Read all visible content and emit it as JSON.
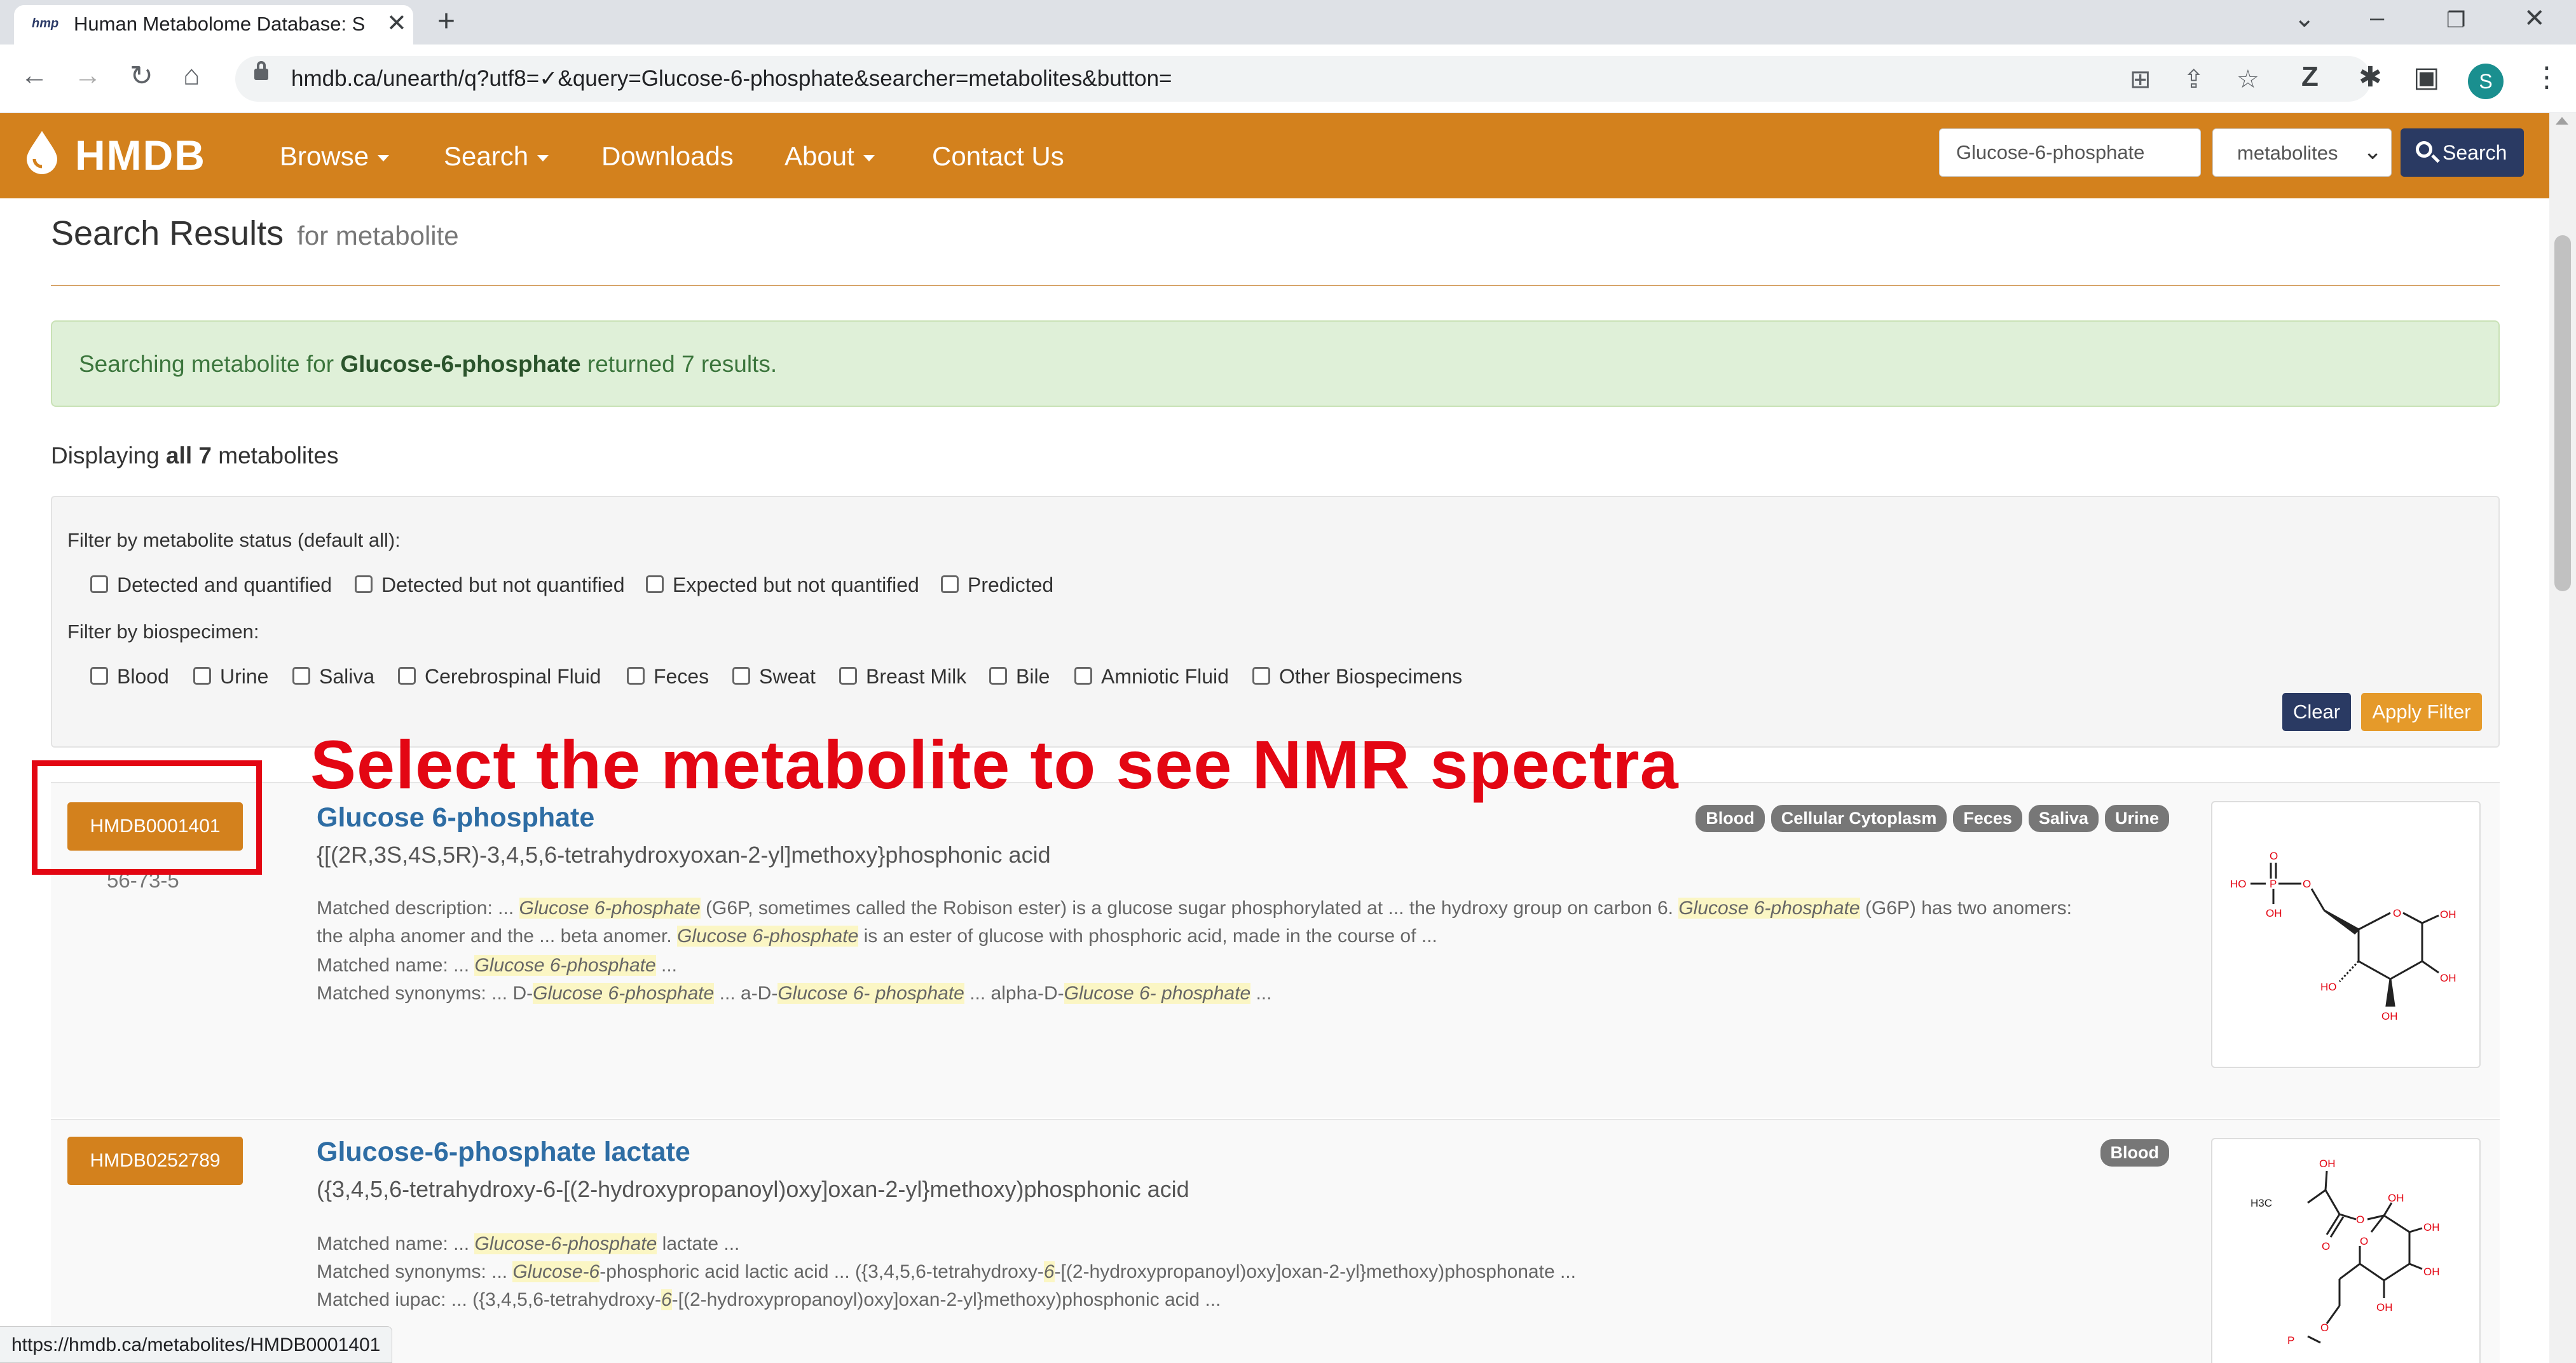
{
  "browser": {
    "tab_favicon": "hmp",
    "tab_title": "Human Metabolome Database: S",
    "url": "hmdb.ca/unearth/q?utf8=✓&query=Glucose-6-phosphate&searcher=metabolites&button=",
    "profile_initial": "S",
    "status_url": "https://hmdb.ca/metabolites/HMDB0001401"
  },
  "navbar": {
    "logo": "HMDB",
    "items": [
      "Browse",
      "Search",
      "Downloads",
      "About",
      "Contact Us"
    ],
    "search_value": "Glucose-6-phosphate",
    "searcher_selected": "metabolites",
    "search_button": "Search",
    "brand_color": "#d3811d"
  },
  "page": {
    "title": "Search Results",
    "title_suffix": "for metabolite",
    "alert_prefix": "Searching metabolite for ",
    "alert_query": "Glucose-6-phosphate",
    "alert_suffix": " returned 7 results.",
    "displaying_prefix": "Displaying ",
    "displaying_count": "all 7",
    "displaying_suffix": " metabolites"
  },
  "filters": {
    "status_label": "Filter by metabolite status (default all):",
    "status_options": [
      "Detected and quantified",
      "Detected but not quantified",
      "Expected but not quantified",
      "Predicted"
    ],
    "biospecimen_label": "Filter by biospecimen:",
    "biospecimen_options": [
      "Blood",
      "Urine",
      "Saliva",
      "Cerebrospinal Fluid",
      "Feces",
      "Sweat",
      "Breast Milk",
      "Bile",
      "Amniotic Fluid",
      "Other Biospecimens"
    ],
    "clear_label": "Clear",
    "apply_label": "Apply Filter"
  },
  "annotation": {
    "text": "Select the metabolite to see  NMR spectra",
    "color": "#e30613"
  },
  "results": [
    {
      "id": "HMDB0001401",
      "cas": "56-73-5",
      "name": "Glucose 6-phosphate",
      "iupac": "{[(2R,3S,4S,5R)-3,4,5,6-tetrahydroxyoxan-2-yl]methoxy}phosphonic acid",
      "tags": [
        "Blood",
        "Cellular Cytoplasm",
        "Feces",
        "Saliva",
        "Urine"
      ],
      "desc_label": "Matched description:",
      "desc_l1a": " ... ",
      "desc_hl1": "Glucose 6-phosphate",
      "desc_l1b": " (G6P, sometimes called the Robison ester) is a glucose sugar phosphorylated at ... the hydroxy group on carbon 6. ",
      "desc_hl2": "Glucose 6-phosphate",
      "desc_l1c": " (G6P) has two anomers:",
      "desc_l2a": "the alpha anomer and the ... beta anomer. ",
      "desc_hl3": "Glucose 6-phosphate",
      "desc_l2b": " is an ester of glucose with phosphoric acid, made in the course of ...",
      "name_label": "Matched name:",
      "name_a": " ... ",
      "name_hl": "Glucose 6-phosphate",
      "name_b": " ...",
      "syn_label": "Matched synonyms:",
      "syn_a": " ... D-",
      "syn_hl1": "Glucose 6-phosphate",
      "syn_b": " ... a-D-",
      "syn_hl2": "Glucose 6- phosphate",
      "syn_c": " ... alpha-D-",
      "syn_hl3": "Glucose 6- phosphate",
      "syn_d": " ..."
    },
    {
      "id": "HMDB0252789",
      "name": "Glucose-6-phosphate lactate",
      "iupac": "({3,4,5,6-tetrahydroxy-6-[(2-hydroxypropanoyl)oxy]oxan-2-yl}methoxy)phosphonic acid",
      "tags": [
        "Blood"
      ],
      "name_label": "Matched name:",
      "name_a": " ... ",
      "name_hl": "Glucose-6-phosphate",
      "name_b": " lactate ...",
      "syn_label": "Matched synonyms:",
      "syn_a": " ... ",
      "syn_hl1": "Glucose-6",
      "syn_b": "-phosphoric acid lactic acid ... ({3,4,5,6-tetrahydroxy-",
      "syn_hl2": "6",
      "syn_c": "-[(2-hydroxypropanoyl)oxy]oxan-2-yl}methoxy)phosphonate ...",
      "iupac_label": "Matched iupac:",
      "iu_a": " ... ({3,4,5,6-tetrahydroxy-",
      "iu_hl": "6",
      "iu_b": "-[(2-hydroxypropanoyl)oxy]oxan-2-yl}methoxy)phosphonic acid ..."
    }
  ],
  "structure_labels": {
    "ho": "HO",
    "o": "O",
    "p": "P",
    "oh": "OH",
    "h3c": "H3C"
  }
}
